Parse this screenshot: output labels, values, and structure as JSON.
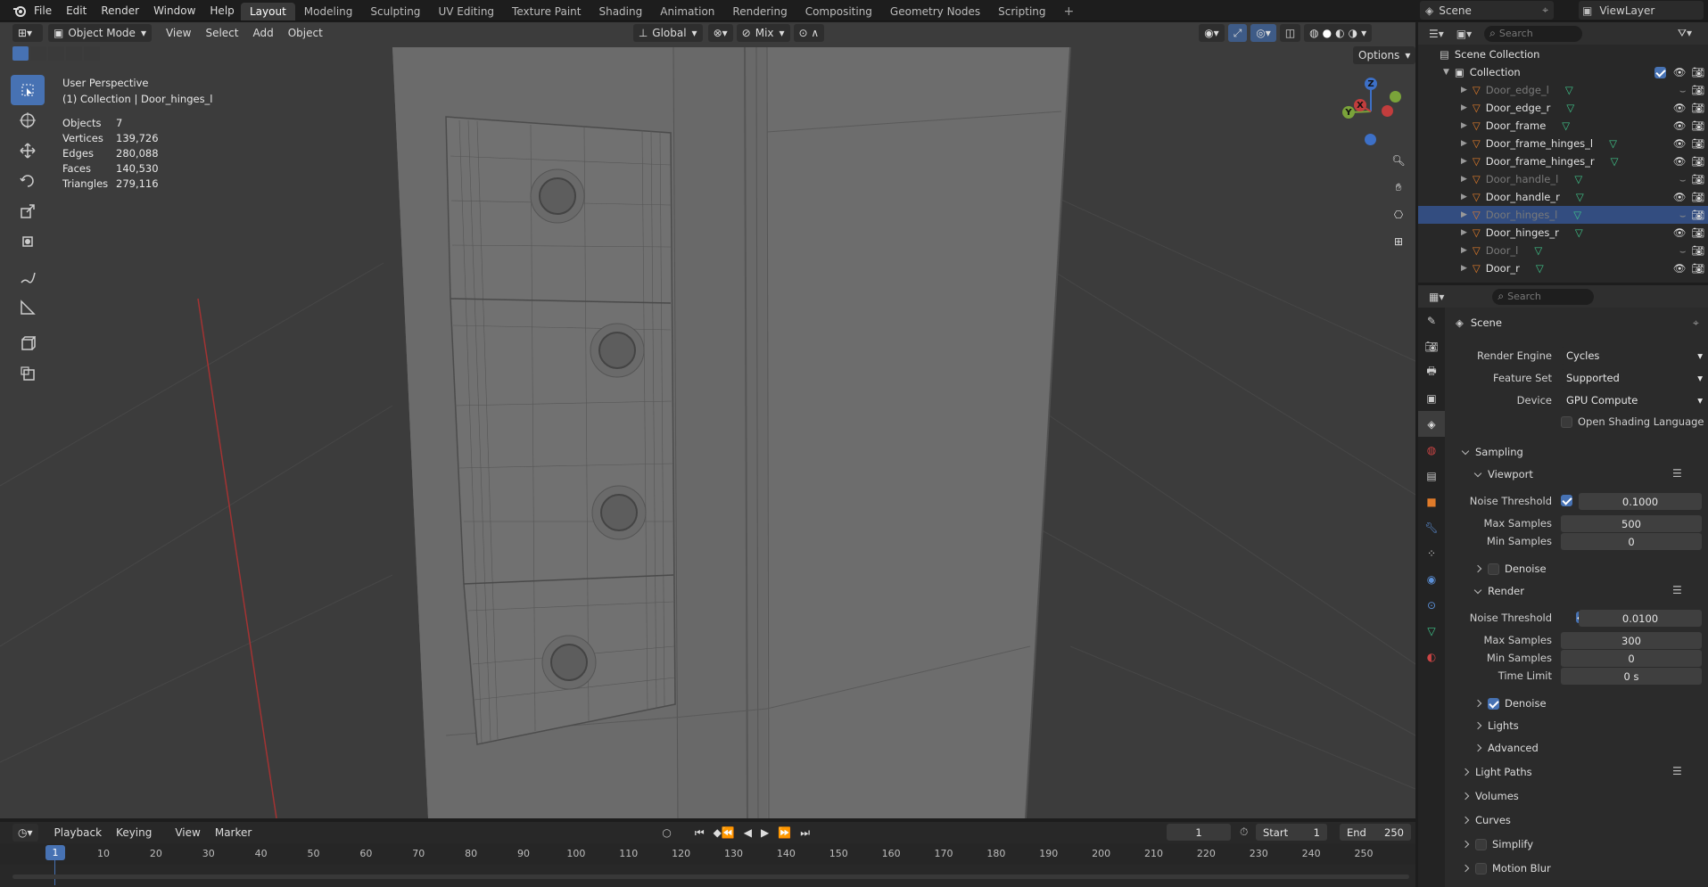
{
  "topbar": {
    "menus": [
      "File",
      "Edit",
      "Render",
      "Window",
      "Help"
    ],
    "workspaces": [
      "Layout",
      "Modeling",
      "Sculpting",
      "UV Editing",
      "Texture Paint",
      "Shading",
      "Animation",
      "Rendering",
      "Compositing",
      "Geometry Nodes",
      "Scripting"
    ],
    "active_workspace": "Layout",
    "scene": "Scene",
    "view_layer": "ViewLayer"
  },
  "viewport": {
    "mode": "Object Mode",
    "menus": [
      "View",
      "Select",
      "Add",
      "Object"
    ],
    "orientation": "Global",
    "snap_mode": "Mix",
    "options": "Options",
    "view_name": "User Perspective",
    "collection_line": "(1) Collection | Door_hinges_l",
    "stats": [
      {
        "k": "Objects",
        "v": "7"
      },
      {
        "k": "Vertices",
        "v": "139,726"
      },
      {
        "k": "Edges",
        "v": "280,088"
      },
      {
        "k": "Faces",
        "v": "140,530"
      },
      {
        "k": "Triangles",
        "v": "279,116"
      }
    ],
    "gizmo": {
      "z": "Z",
      "y": "Y",
      "x": "X"
    }
  },
  "outliner": {
    "search_placeholder": "Search",
    "scene_collection": "Scene Collection",
    "collection": "Collection",
    "items": [
      {
        "name": "Door_edge_l",
        "visible": false
      },
      {
        "name": "Door_edge_r",
        "visible": true
      },
      {
        "name": "Door_frame",
        "visible": true
      },
      {
        "name": "Door_frame_hinges_l",
        "visible": true
      },
      {
        "name": "Door_frame_hinges_r",
        "visible": true
      },
      {
        "name": "Door_handle_l",
        "visible": false
      },
      {
        "name": "Door_handle_r",
        "visible": true
      },
      {
        "name": "Door_hinges_l",
        "visible": false,
        "selected": true
      },
      {
        "name": "Door_hinges_r",
        "visible": true
      },
      {
        "name": "Door_l",
        "visible": false
      },
      {
        "name": "Door_r",
        "visible": true
      }
    ]
  },
  "properties": {
    "search_placeholder": "Search",
    "context": "Scene",
    "render_engine_label": "Render Engine",
    "render_engine": "Cycles",
    "feature_set_label": "Feature Set",
    "feature_set": "Supported",
    "device_label": "Device",
    "device": "GPU Compute",
    "osl_label": "Open Shading Language",
    "sampling": "Sampling",
    "viewport": "Viewport",
    "render": "Render",
    "noise_threshold_label": "Noise Threshold",
    "max_samples_label": "Max Samples",
    "min_samples_label": "Min Samples",
    "time_limit_label": "Time Limit",
    "vp_noise": "0.1000",
    "vp_max": "500",
    "vp_min": "0",
    "r_noise": "0.0100",
    "r_max": "300",
    "r_min": "0",
    "r_time": "0 s",
    "denoise": "Denoise",
    "lights": "Lights",
    "advanced": "Advanced",
    "light_paths": "Light Paths",
    "volumes": "Volumes",
    "curves": "Curves",
    "simplify": "Simplify",
    "motion_blur": "Motion Blur"
  },
  "timeline": {
    "menus": [
      "Playback",
      "Keying",
      "View",
      "Marker"
    ],
    "current_frame": "1",
    "start_label": "Start",
    "start": "1",
    "end_label": "End",
    "end": "250",
    "ticks": [
      "1",
      "10",
      "20",
      "30",
      "40",
      "50",
      "60",
      "70",
      "80",
      "90",
      "100",
      "110",
      "120",
      "130",
      "140",
      "150",
      "160",
      "170",
      "180",
      "190",
      "200",
      "210",
      "220",
      "230",
      "240",
      "250"
    ]
  }
}
